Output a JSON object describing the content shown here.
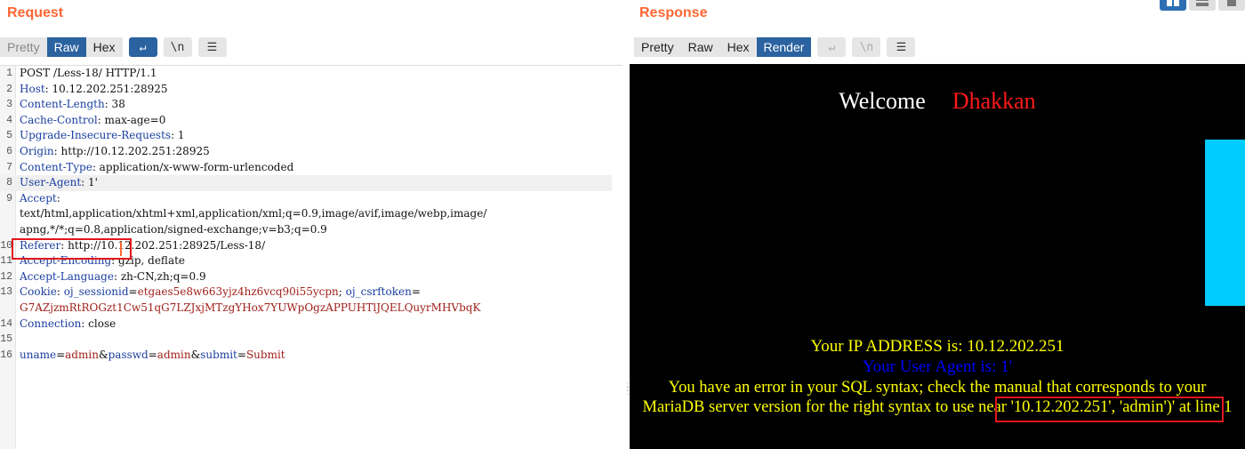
{
  "request": {
    "title": "Request",
    "tabs": [
      "Pretty",
      "Raw",
      "Hex"
    ],
    "icons": [
      "↵",
      "\\n",
      "☰"
    ],
    "lines": [
      {
        "n": "1",
        "parts": [
          {
            "t": "POST /Less-18/ HTTP/1.1",
            "c": ""
          }
        ]
      },
      {
        "n": "2",
        "parts": [
          {
            "t": "Host",
            "c": "k"
          },
          {
            "t": ": 10.12.202.251:28925",
            "c": ""
          }
        ]
      },
      {
        "n": "3",
        "parts": [
          {
            "t": "Content-Length",
            "c": "k"
          },
          {
            "t": ": 38",
            "c": ""
          }
        ]
      },
      {
        "n": "4",
        "parts": [
          {
            "t": "Cache-Control",
            "c": "k"
          },
          {
            "t": ": max-age=0",
            "c": ""
          }
        ]
      },
      {
        "n": "5",
        "parts": [
          {
            "t": "Upgrade-Insecure-Requests",
            "c": "k"
          },
          {
            "t": ": 1",
            "c": ""
          }
        ]
      },
      {
        "n": "6",
        "parts": [
          {
            "t": "Origin",
            "c": "k"
          },
          {
            "t": ": http://10.12.202.251:28925",
            "c": ""
          }
        ]
      },
      {
        "n": "7",
        "parts": [
          {
            "t": "Content-Type",
            "c": "k"
          },
          {
            "t": ": application/x-www-form-urlencoded",
            "c": ""
          }
        ]
      },
      {
        "n": "8",
        "parts": [
          {
            "t": "User-Agent",
            "c": "k"
          },
          {
            "t": ": 1'",
            "c": ""
          }
        ],
        "hl": true
      },
      {
        "n": "9",
        "parts": [
          {
            "t": "Accept",
            "c": "k"
          },
          {
            "t": ":",
            "c": ""
          }
        ]
      },
      {
        "n": "",
        "parts": [
          {
            "t": "text/html,application/xhtml+xml,application/xml;q=0.9,image/avif,image/webp,image/",
            "c": ""
          }
        ]
      },
      {
        "n": "",
        "parts": [
          {
            "t": "apng,*/*;q=0.8,application/signed-exchange;v=b3;q=0.9",
            "c": ""
          }
        ]
      },
      {
        "n": "10",
        "parts": [
          {
            "t": "Referer",
            "c": "k"
          },
          {
            "t": ": http://10.12.202.251:28925/Less-18/",
            "c": ""
          }
        ]
      },
      {
        "n": "11",
        "parts": [
          {
            "t": "Accept-Encoding",
            "c": "k"
          },
          {
            "t": ": gzip, deflate",
            "c": ""
          }
        ]
      },
      {
        "n": "12",
        "parts": [
          {
            "t": "Accept-Language",
            "c": "k"
          },
          {
            "t": ": zh-CN,zh;q=0.9",
            "c": ""
          }
        ]
      },
      {
        "n": "13",
        "parts": [
          {
            "t": "Cookie",
            "c": "k"
          },
          {
            "t": ": ",
            "c": ""
          },
          {
            "t": "oj_sessionid",
            "c": "k"
          },
          {
            "t": "=",
            "c": ""
          },
          {
            "t": "etgaes5e8w663yjz4hz6vcq90i55ycpn",
            "c": "cv"
          },
          {
            "t": "; ",
            "c": ""
          },
          {
            "t": "oj_csrftoken",
            "c": "k"
          },
          {
            "t": "=",
            "c": ""
          }
        ]
      },
      {
        "n": "",
        "parts": [
          {
            "t": "G7AZjzmRtROGzt1Cw51qG7LZJxjMTzgYHox7YUWpOgzAPPUHTlJQELQuyrMHVbqK",
            "c": "cv"
          }
        ]
      },
      {
        "n": "14",
        "parts": [
          {
            "t": "Connection",
            "c": "k"
          },
          {
            "t": ": close",
            "c": ""
          }
        ]
      },
      {
        "n": "15",
        "parts": [
          {
            "t": "",
            "c": ""
          }
        ]
      },
      {
        "n": "16",
        "parts": [
          {
            "t": "uname",
            "c": "pk"
          },
          {
            "t": "=",
            "c": ""
          },
          {
            "t": "admin",
            "c": "pv"
          },
          {
            "t": "&",
            "c": ""
          },
          {
            "t": "passwd",
            "c": "pk"
          },
          {
            "t": "=",
            "c": ""
          },
          {
            "t": "admin",
            "c": "pv"
          },
          {
            "t": "&",
            "c": ""
          },
          {
            "t": "submit",
            "c": "pk"
          },
          {
            "t": "=",
            "c": ""
          },
          {
            "t": "Submit",
            "c": "pv"
          }
        ]
      }
    ]
  },
  "response": {
    "title": "Response",
    "tabs": [
      "Pretty",
      "Raw",
      "Hex",
      "Render"
    ],
    "icons": [
      "↵",
      "\\n",
      "☰"
    ],
    "render": {
      "welcome": "Welcome",
      "name": "Dhakkan",
      "ip_line": "Your IP ADDRESS is: 10.12.202.251",
      "ua_line": "Your User Agent is: 1'",
      "error_line": "You have an error in your SQL syntax; check the manual that corresponds to your MariaDB server version for the right syntax to use near '10.12.202.251', 'admin')' at line 1"
    }
  },
  "colors": {
    "accent": "#ff6633",
    "active_tab": "#2b62a0",
    "highlight_box": "#e3161b",
    "render_bg": "#000000",
    "render_yellow": "#ffff00",
    "render_blue": "#0000ff",
    "render_red": "#ff1a1a",
    "render_cyan": "#00ccff"
  }
}
